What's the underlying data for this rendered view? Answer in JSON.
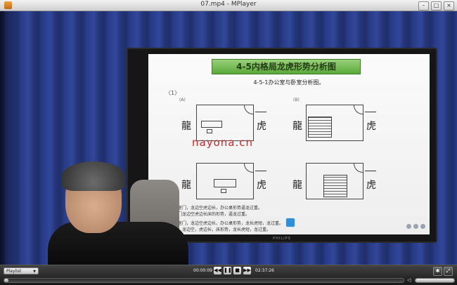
{
  "window": {
    "title": "07.mp4 - MPlayer"
  },
  "slide": {
    "title": "4-5内格局龙虎形势分析图",
    "subtitle": "4-5-1办公室与卧室分析图。",
    "number": "〈1〉",
    "figure_a": "(A)",
    "figure_b": "(B)",
    "dragon": "龍",
    "tiger": "虎",
    "note_lines": [
      "公室门，龙边空虎边长，办公桌形势逼龙过重。",
      "室门龙边空虎边长床的形势，逼龙过重。",
      "公室门，龙边空虎边长，办公桌形势，龙长虎短，龙过重。",
      "门，龙边空，虎边长，床形势，龙长虎短，龙过重。"
    ],
    "tv_brand": "PHILIPS"
  },
  "watermark": "nayona.cn",
  "controls": {
    "playlist_label": "Playlist",
    "current_time": "00:00:09",
    "total_time": "02:37:26",
    "seek_progress": 0.0006,
    "volume_level": 1.0,
    "icons": [
      "rewind-icon",
      "pause-icon",
      "stop-icon",
      "fast-forward-icon",
      "settings-icon",
      "fullscreen-icon",
      "volume-icon"
    ]
  }
}
